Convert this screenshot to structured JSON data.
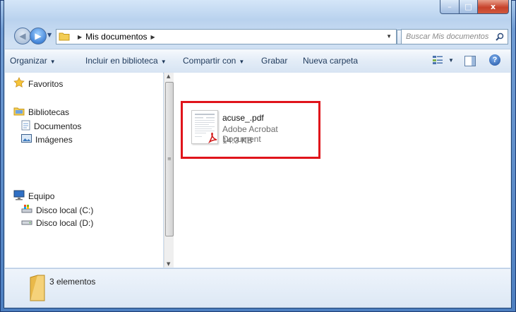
{
  "window": {
    "controls": {
      "minimize": "–",
      "maximize": "□",
      "close": "x"
    }
  },
  "address_bar": {
    "path": [
      "Mis documentos"
    ],
    "search_placeholder": "Buscar Mis documentos"
  },
  "toolbar": {
    "items": [
      {
        "label": "Organizar",
        "dropdown": true
      },
      {
        "label": "Incluir en biblioteca",
        "dropdown": true
      },
      {
        "label": "Compartir con",
        "dropdown": true
      },
      {
        "label": "Grabar",
        "dropdown": false
      },
      {
        "label": "Nueva carpeta",
        "dropdown": false
      }
    ],
    "help_label": "?"
  },
  "navigation": {
    "favorites": {
      "label": "Favoritos",
      "icon": "star-icon"
    },
    "libraries": {
      "label": "Bibliotecas",
      "icon": "library-icon",
      "items": [
        {
          "label": "Documentos",
          "icon": "document-icon"
        },
        {
          "label": "Imágenes",
          "icon": "picture-icon"
        }
      ]
    },
    "computer": {
      "label": "Equipo",
      "icon": "computer-icon",
      "items": [
        {
          "label": "Disco local (C:)",
          "icon": "system-drive-icon"
        },
        {
          "label": "Disco local (D:)",
          "icon": "drive-icon"
        }
      ]
    }
  },
  "files": [
    {
      "name": "acuse_.pdf",
      "type": "Adobe Acrobat Document",
      "size": "14.3 KB",
      "icon": "pdf-icon",
      "highlighted": true,
      "highlight_color": "#e0141b"
    }
  ],
  "status_bar": {
    "count_text": "3 elementos"
  },
  "colors": {
    "highlight": "#e0141b",
    "window_frame": "#4d7fc0",
    "toolbar_text": "#1e395b"
  }
}
